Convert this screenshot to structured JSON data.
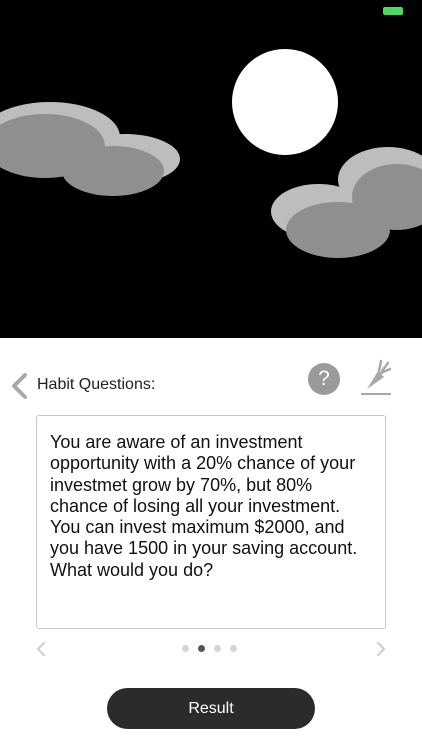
{
  "header": {
    "title": "Habit Questions:"
  },
  "help": {
    "label": "?"
  },
  "question": {
    "text": "You are aware of an investment opportunity with a 20% chance of your investmet grow by 70%, but 80% chance of losing all your investment. You can invest maximum $2000, and you have 1500 in your saving account. What would you do?"
  },
  "pager": {
    "count": 4,
    "active_index": 1
  },
  "actions": {
    "result_label": "Result"
  },
  "colors": {
    "scene_bg": "#000000",
    "battery": "#4cd964",
    "button_bg": "#2b2b2b"
  },
  "icons": [
    "back-chevron-icon",
    "help-icon",
    "carrot-icon",
    "prev-chevron-icon",
    "next-chevron-icon"
  ]
}
